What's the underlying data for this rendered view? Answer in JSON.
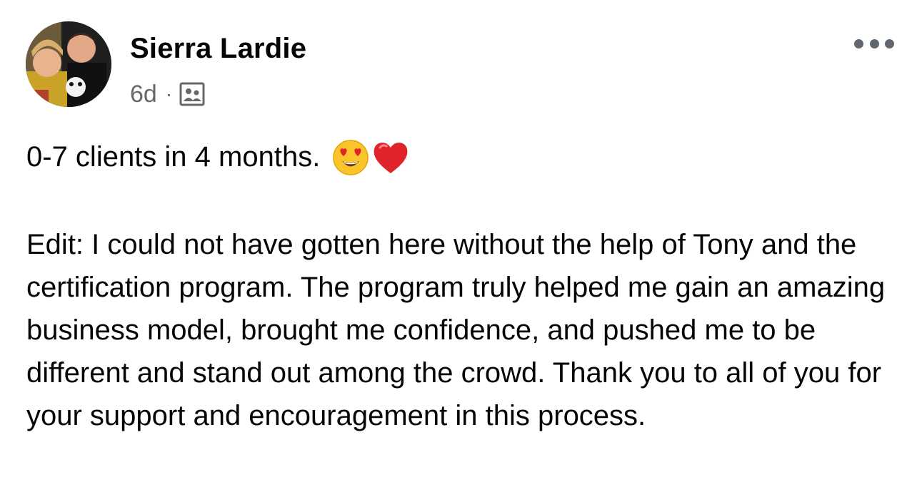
{
  "post": {
    "author": "Sierra Lardie",
    "time": "6d",
    "separator": "·",
    "audience_icon": "group-icon",
    "more_icon": "more-dots-icon",
    "headline": "0-7 clients in 4 months.",
    "headline_emojis": [
      "heart-eyes-emoji",
      "red-heart-emoji"
    ],
    "body": "Edit: I could not have gotten here without the help of Tony and the certification program. The program truly helped me gain an amazing business model, brought me confidence, and pushed me to be different and stand out among the crowd. Thank you to all of you for your support and encouragement in this process."
  },
  "colors": {
    "text": "#050505",
    "secondary_text": "#65676b",
    "icon": "#606770",
    "heart": "#e0242b",
    "emoji_face": "#f9c52b"
  }
}
